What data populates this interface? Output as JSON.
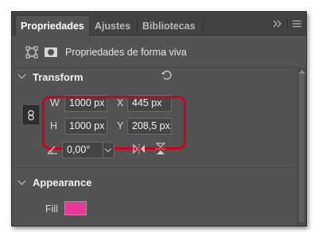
{
  "tabs": [
    {
      "label": "Propriedades",
      "active": true
    },
    {
      "label": "Ajustes",
      "active": false
    },
    {
      "label": "Bibliotecas",
      "active": false
    }
  ],
  "tabbar_icons": {
    "expand": "double-chevron-right-icon",
    "menu": "hamburger-menu-icon"
  },
  "header": {
    "title": "Propriedades de forma viva",
    "shape_icon": "rectangle-shape-icon",
    "mask_icon": "mask-icon"
  },
  "transform": {
    "title": "Transform",
    "reset_icon": "reset-icon",
    "link_icon": "link-chain-icon",
    "w_label": "W",
    "w_value": "1000 px",
    "h_label": "H",
    "h_value": "1000 px",
    "x_label": "X",
    "x_value": "445 px",
    "y_label": "Y",
    "y_value": "208,5 px",
    "angle_value": "0,00°",
    "flip_h_icon": "flip-horizontal-icon",
    "flip_v_icon": "flip-vertical-icon"
  },
  "appearance": {
    "title": "Appearance",
    "fill_label": "Fill",
    "fill_color": "#e8399a"
  },
  "colors": {
    "panel": "#535353",
    "tabbar": "#424242",
    "highlight": "#d0021b"
  }
}
